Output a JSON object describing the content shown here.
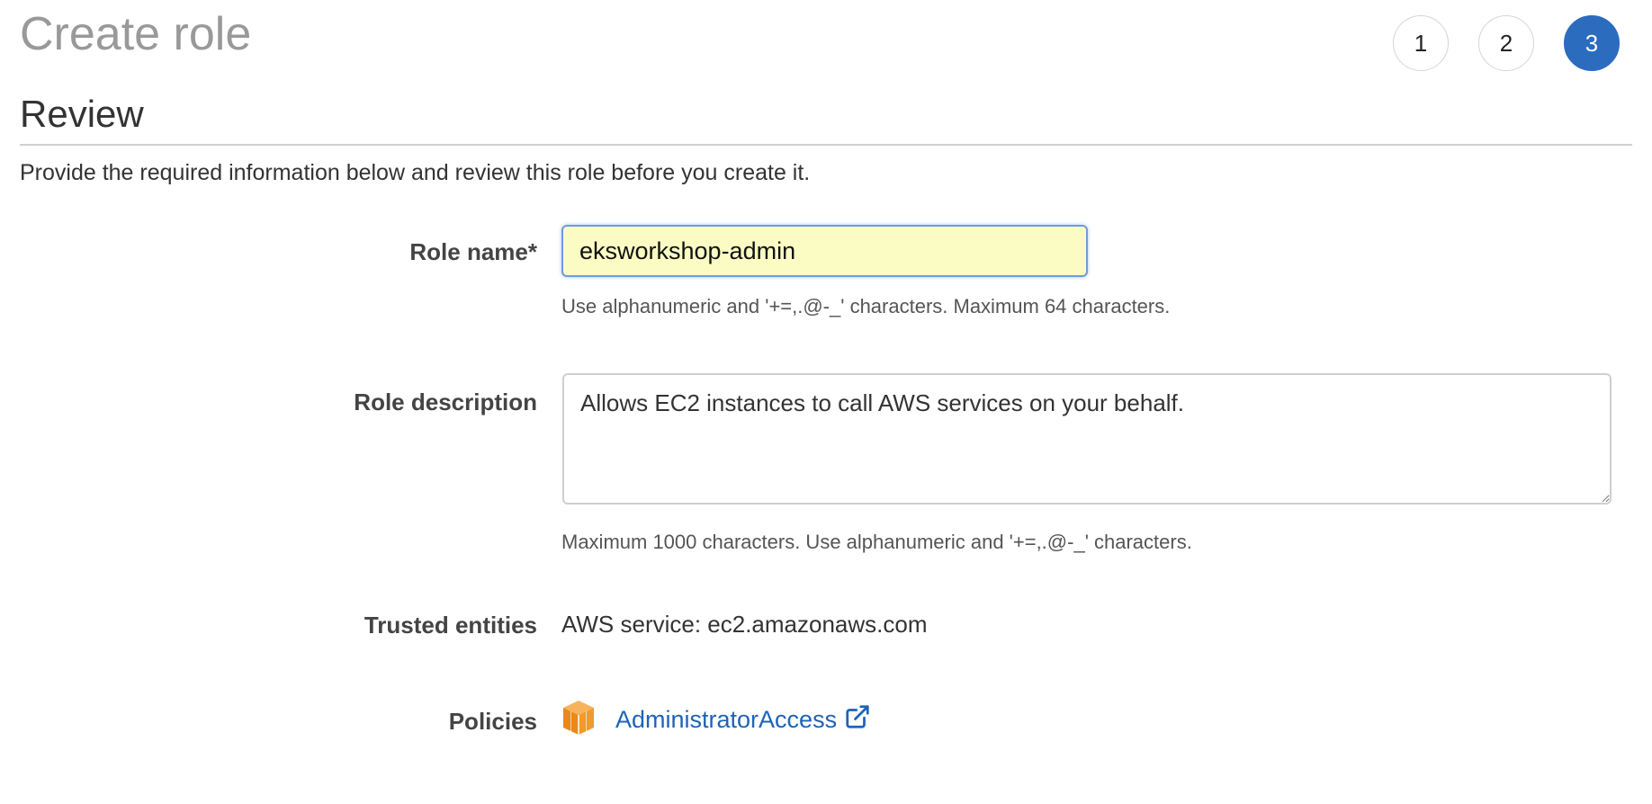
{
  "header": {
    "title": "Create role",
    "steps": [
      {
        "label": "1",
        "active": false
      },
      {
        "label": "2",
        "active": false
      },
      {
        "label": "3",
        "active": true
      }
    ],
    "step_active_color": "#2b6cbf"
  },
  "review": {
    "title": "Review",
    "intro": "Provide the required information below and review this role before you create it."
  },
  "form": {
    "role_name": {
      "label": "Role name*",
      "value": "eksworkshop-admin",
      "hint": "Use alphanumeric and '+=,.@-_' characters. Maximum 64 characters."
    },
    "role_description": {
      "label": "Role description",
      "value": "Allows EC2 instances to call AWS services on your behalf.",
      "hint": "Maximum 1000 characters. Use alphanumeric and '+=,.@-_' characters."
    },
    "trusted_entities": {
      "label": "Trusted entities",
      "value": "AWS service: ec2.amazonaws.com"
    },
    "policies": {
      "label": "Policies",
      "items": [
        {
          "name": "AdministratorAccess",
          "icon": "aws-box-icon",
          "link_icon": "external-link-icon"
        }
      ]
    }
  },
  "colors": {
    "link": "#1e63b5",
    "input_highlight": "#fbfcc4",
    "policy_icon": "#f29a2e"
  }
}
